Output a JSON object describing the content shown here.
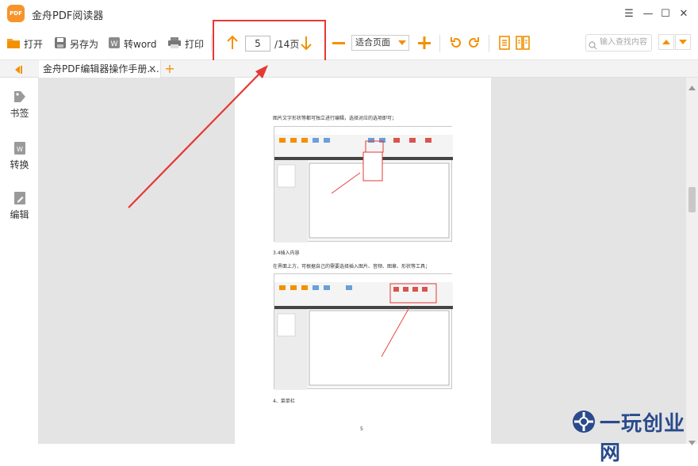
{
  "app": {
    "logo_text": "PDF",
    "title": "金舟PDF阅读器"
  },
  "window_controls": {
    "menu": "☰",
    "minimize": "—",
    "maximize": "☐",
    "close": "✕"
  },
  "toolbar": {
    "open_label": "打开",
    "saveas_label": "另存为",
    "toword_label": "转word",
    "print_label": "打印",
    "page_current": "5",
    "page_total": "/14页",
    "zoom_value": "适合页面",
    "search_placeholder": "输入查找内容"
  },
  "tabs": [
    {
      "label": "金舟PDF编辑器操作手册....",
      "close": "✕"
    }
  ],
  "tab_add": "+",
  "sidebar": {
    "items": [
      {
        "label": "书签",
        "icon": "bookmark-icon"
      },
      {
        "label": "转换",
        "icon": "convert-icon"
      },
      {
        "label": "编辑",
        "icon": "edit-icon"
      }
    ]
  },
  "document": {
    "line1": "图片文字形状等都可独立进行编辑，选择对应的选项即可；",
    "section1": "3.4插入内容",
    "line2": "在界面上方，可根据自己的需要选择插入图片、音频、图章、形状等工具；",
    "section2": "4、菜单栏",
    "page_number": "5"
  },
  "watermark": {
    "text": "一玩创业网"
  },
  "colors": {
    "accent": "#f29100",
    "highlight_red": "#e53935",
    "doc_bg": "#e4e4e4"
  }
}
